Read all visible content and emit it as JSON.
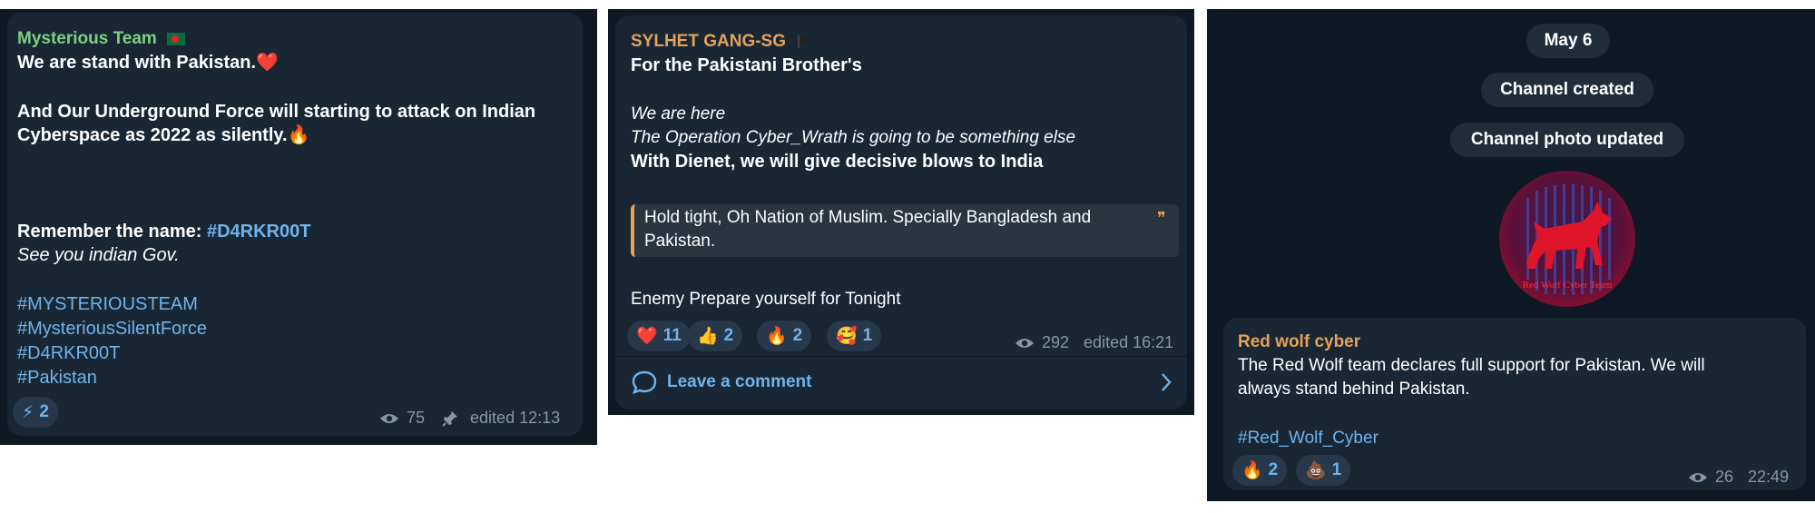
{
  "post1": {
    "sender": "Mysterious Team",
    "line1": "We are stand with Pakistan.",
    "line1_emoji": "❤️",
    "para2_line1": "And Our Underground Force will starting to attack on Indian",
    "para2_line2": "Cyberspace as 2022 as silently.",
    "para2_emoji": "🔥",
    "remember_prefix": "Remember the name: ",
    "remember_tag": "#D4RKR00T",
    "see_you": "See you indian Gov.",
    "hashtags": [
      "#MYSTERIOUSTEAM",
      "#MysteriousSilentForce",
      "#D4RKR00T",
      "#Pakistan"
    ],
    "reaction": {
      "emoji": "⚡",
      "count": "2"
    },
    "views": "75",
    "edited": "edited 12:13"
  },
  "post2": {
    "sender": "SYLHET GANG-SG",
    "line1": "For the Pakistani Brother's",
    "italic1": "We are here",
    "italic2": "The Operation Cyber_Wrath is going to be something else",
    "line_bold": "With Dienet, we will give decisive blows to India",
    "quote_line1": "Hold tight, Oh Nation of Muslim. Specially  Bangladesh and",
    "quote_line2": "Pakistan.",
    "quote_mark": "❞",
    "line_last": "Enemy Prepare yourself for Tonight",
    "reactions": [
      {
        "emoji": "❤️",
        "count": "11"
      },
      {
        "emoji": "👍",
        "count": "2"
      },
      {
        "emoji": "🔥",
        "count": "2"
      },
      {
        "emoji": "🥰",
        "count": "1"
      }
    ],
    "views": "292",
    "edited": "edited 16:21",
    "comment": "Leave a comment"
  },
  "post3": {
    "date": "May 6",
    "service1": "Channel created",
    "service2": "Channel photo updated",
    "logo_text": "Red Wolf Cyber Team",
    "sender": "Red wolf cyber",
    "text_line1": "The Red Wolf team declares full support for Pakistan. We will",
    "text_line2": "always stand behind Pakistan.",
    "hashtag": "#Red_Wolf_Cyber",
    "reactions": [
      {
        "emoji": "🔥",
        "count": "2"
      },
      {
        "emoji": "💩",
        "count": "1"
      }
    ],
    "views": "26",
    "time": "22:49"
  },
  "colors": {
    "bg": "#0f1924",
    "bubble": "#192734",
    "link": "#6fb3ec",
    "sender_green": "#7fcf83",
    "sender_orange": "#e6a15a",
    "muted": "#8496a7"
  }
}
